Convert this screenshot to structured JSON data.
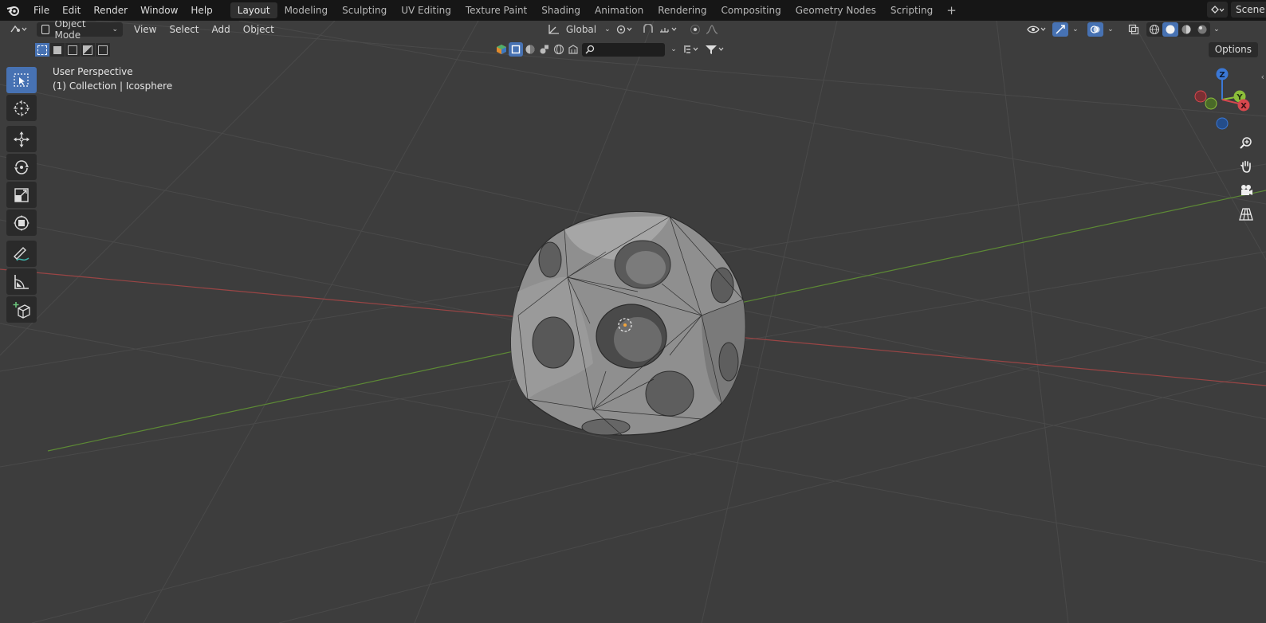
{
  "topbar": {
    "menus": [
      "File",
      "Edit",
      "Render",
      "Window",
      "Help"
    ],
    "tabs": [
      {
        "label": "Layout",
        "active": true
      },
      {
        "label": "Modeling",
        "active": false
      },
      {
        "label": "Sculpting",
        "active": false
      },
      {
        "label": "UV Editing",
        "active": false
      },
      {
        "label": "Texture Paint",
        "active": false
      },
      {
        "label": "Shading",
        "active": false
      },
      {
        "label": "Animation",
        "active": false
      },
      {
        "label": "Rendering",
        "active": false
      },
      {
        "label": "Compositing",
        "active": false
      },
      {
        "label": "Geometry Nodes",
        "active": false
      },
      {
        "label": "Scripting",
        "active": false
      }
    ],
    "scene_label": "Scene"
  },
  "header": {
    "mode": "Object Mode",
    "menus": [
      "View",
      "Select",
      "Add",
      "Object"
    ],
    "transform_orientation": "Global",
    "options_label": "Options"
  },
  "overlay": {
    "view_name": "User Perspective",
    "collection_info": "(1) Collection | Icosphere"
  },
  "gizmo": {
    "z_label": "Z",
    "y_label": "Y",
    "x_label": "X"
  },
  "colors": {
    "accent": "#4772b3",
    "viewport_bg": "#3d3d3d",
    "x_axis": "#a34848",
    "y_axis": "#6a9a38"
  },
  "icons": [
    "blender-logo-icon",
    "editor-type-icon",
    "object-mode-icon",
    "pivot-icon",
    "snap-icon",
    "proportional-edit-icon",
    "select-box-icon",
    "cursor-icon",
    "move-icon",
    "rotate-icon",
    "scale-icon",
    "transform-icon",
    "annotate-icon",
    "measure-icon",
    "add-cube-icon",
    "zoom-icon",
    "hand-icon",
    "camera-icon",
    "grid-icon",
    "search-icon",
    "filter-icon"
  ]
}
